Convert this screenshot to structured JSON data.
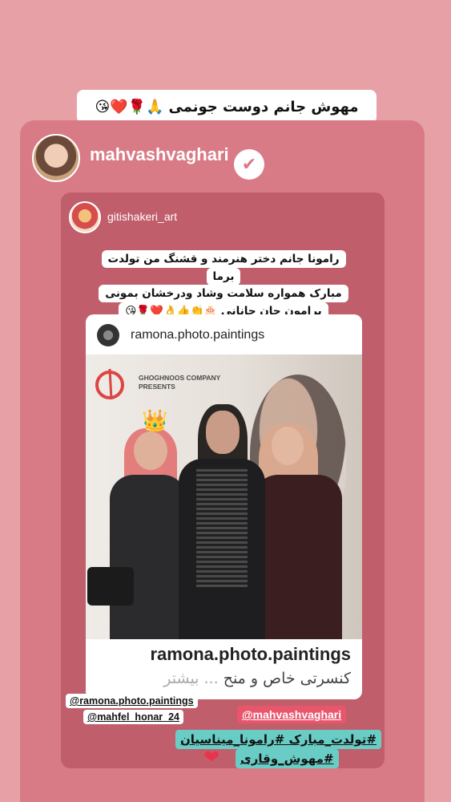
{
  "story": {
    "caption": "مهوش جانم دوست جونمی",
    "caption_emojis": "🙏🌹❤️😘"
  },
  "main_account": {
    "username": "mahvashvaghari",
    "verified_icon": "✔"
  },
  "shared_post": {
    "username": "gitishakeri_art",
    "caption_lines": [
      "رامونا جانم دختر هنرمند و قشنگ من تولدت برما",
      "مبارک همواره سلامت وشاد ودرخشان بمونی",
      "برامون جان جانانی 🎂👏👍👌❤️🌹😘"
    ]
  },
  "embedded_post": {
    "username": "ramona.photo.paintings",
    "photo_company_line1": "GHOGHNOOS COMPANY",
    "photo_company_line2": "PRESENTS",
    "crown_emoji": "👑",
    "footer_username": "ramona.photo.paintings",
    "footer_desc": "کنسرتی خاص و منح",
    "footer_more": "... بیشتر"
  },
  "mentions": {
    "m1": "@ramona.photo.paintings",
    "m2": "@mahfel_honar_24",
    "m3": "@mahvashvaghari"
  },
  "hashtags": {
    "line1": "#تولدت_مبارک #رامونا_میناسیان",
    "line2": "#مهوش_وقاری"
  },
  "heart_emoji": "❤",
  "colors": {
    "background": "#e7a1a6",
    "outer_card": "#d97b86",
    "inner_card": "#c05e6b",
    "hashtag_bg": "#69cdc5",
    "mention_red": "#e9566c"
  }
}
